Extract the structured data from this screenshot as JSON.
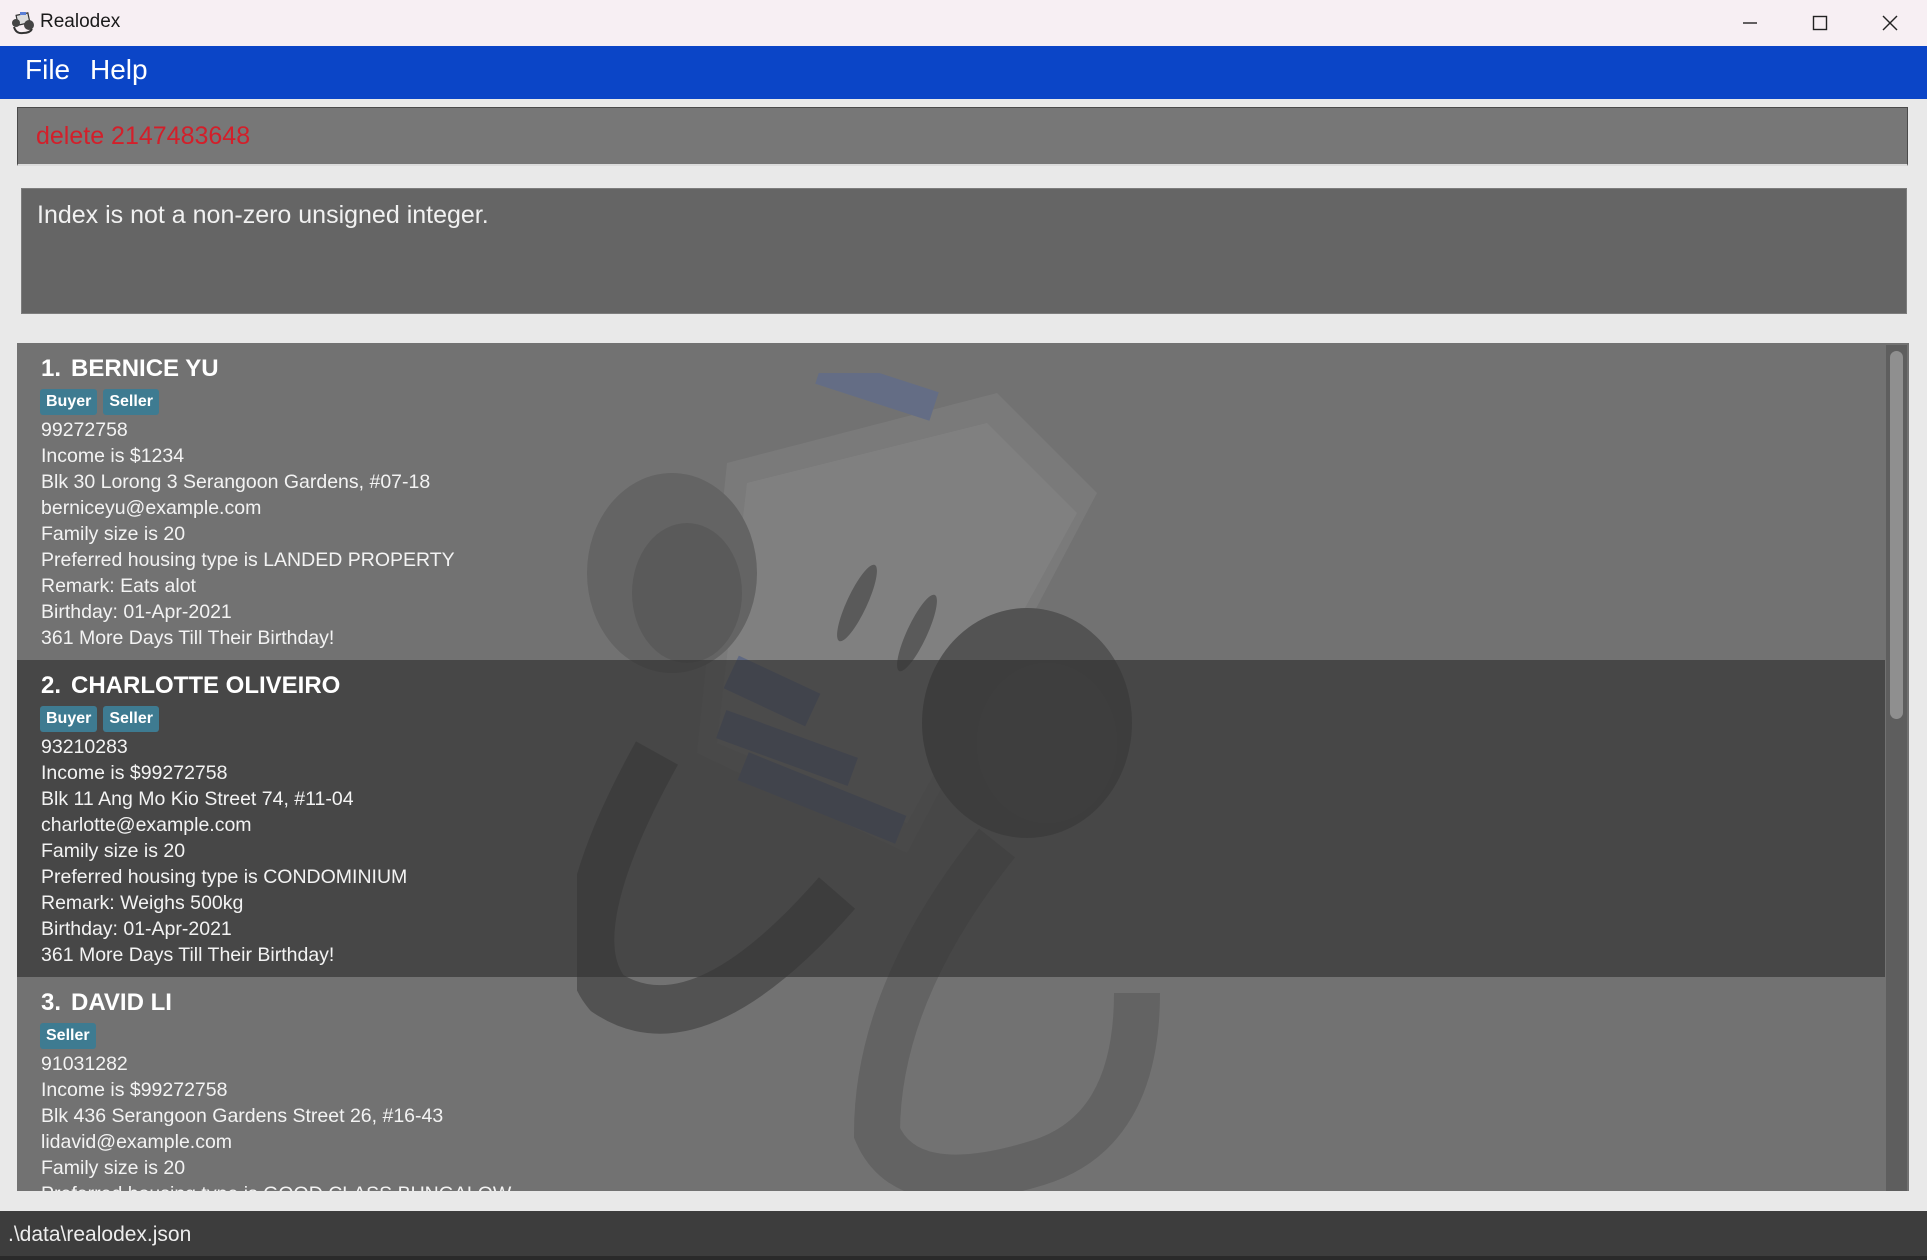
{
  "window": {
    "title": "Realodex"
  },
  "menu": {
    "file": "File",
    "help": "Help"
  },
  "command": {
    "value": "delete 2147483648",
    "color": "#d31f2a"
  },
  "result": {
    "message": "Index is not a non-zero unsigned integer."
  },
  "persons": [
    {
      "index": "1.",
      "name": "BERNICE YU",
      "tags": [
        "Buyer",
        "Seller"
      ],
      "lines": [
        "99272758",
        "Income is $1234",
        "Blk 30 Lorong 3 Serangoon Gardens, #07-18",
        "berniceyu@example.com",
        "Family size is 20",
        "Preferred housing type is LANDED PROPERTY",
        "Remark: Eats alot",
        "Birthday: 01-Apr-2021",
        "361 More Days Till Their Birthday!"
      ]
    },
    {
      "index": "2.",
      "name": "CHARLOTTE OLIVEIRO",
      "tags": [
        "Buyer",
        "Seller"
      ],
      "lines": [
        "93210283",
        "Income is $99272758",
        "Blk 11 Ang Mo Kio Street 74, #11-04",
        "charlotte@example.com",
        "Family size is 20",
        "Preferred housing type is CONDOMINIUM",
        "Remark: Weighs 500kg",
        "Birthday: 01-Apr-2021",
        "361 More Days Till Their Birthday!"
      ]
    },
    {
      "index": "3.",
      "name": "DAVID LI",
      "tags": [
        "Seller"
      ],
      "lines": [
        "91031282",
        "Income is $99272758",
        "Blk 436 Serangoon Gardens Street 26, #16-43",
        "lidavid@example.com",
        "Family size is 20",
        "Preferred housing type is GOOD CLASS BUNGALOW"
      ]
    }
  ],
  "status": {
    "path": ".\\data\\realodex.json"
  },
  "colors": {
    "menubar": "#0b45c7",
    "tag": "#3e7b91",
    "command_bg": "#777777",
    "result_bg": "#656565",
    "statusbar": "#3d3d3d"
  }
}
